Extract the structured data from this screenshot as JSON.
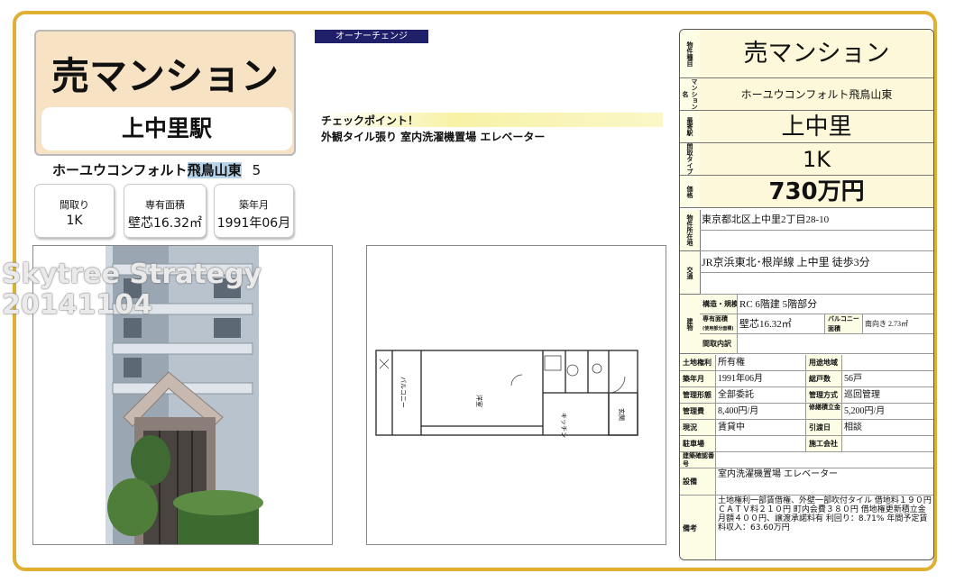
{
  "title": "売マンション",
  "station_title": "上中里駅",
  "property_name_prefix": "ホーユウコンフォルト",
  "property_name_hl": "飛鳥山東",
  "property_number": "5",
  "summary": [
    {
      "label": "間取り",
      "value": "1K"
    },
    {
      "label": "専有面積",
      "value": "壁芯16.32㎡"
    },
    {
      "label": "築年月",
      "value": "1991年06月"
    }
  ],
  "watermark": [
    "Skytree Strategy",
    "20141104"
  ],
  "owner_badge": "オーナーチェンジ",
  "checkpoint": {
    "header": "チェックポイント！",
    "text": "外観タイル張り 室内洗濯機置場 エレベーター"
  },
  "plan_labels": {
    "balcony": "バルコニー",
    "room": "洋室",
    "kitchen": "キッチン",
    "entrance": "玄関"
  },
  "table": {
    "type_label": "物件種目",
    "type_value": "売マンション",
    "name_label": "マンション名",
    "name_value": "ホーユウコンフォルト飛鳥山東",
    "station_label": "最寄駅",
    "station_value": "上中里",
    "layout_label": "間取タイプ",
    "layout_value": "1K",
    "price_label": "価格",
    "price_value": "730万円",
    "address_label": "物件所在地",
    "address_value": "東京都北区上中里2丁目28-10",
    "access_label": "交通",
    "access_value": "JR京浜東北･根岸線 上中里 徒歩3分",
    "building_label": "建物",
    "struct_label": "構造・規模",
    "struct_value": "RC 6階建 5階部分",
    "area_label": "専有面積",
    "area_sub": "(使用部分面積)",
    "area_value": "壁芯16.32㎡",
    "balcony_label": "バルコニー面積",
    "balcony_value": "南向き 2.73㎡",
    "layout_detail_label": "間取内訳",
    "land_right_label": "土地権利",
    "land_right_value": "所有権",
    "use_area_label": "用途地域",
    "built_label": "築年月",
    "built_value": "1991年06月",
    "units_label": "総戸数",
    "units_value": "56戸",
    "mgmt_form_label": "管理形態",
    "mgmt_form_value": "全部委託",
    "mgmt_method_label": "管理方式",
    "mgmt_method_value": "巡回管理",
    "mgmt_fee_label": "管理費",
    "mgmt_fee_value": "8,400円/月",
    "repair_label": "修繕積立金",
    "repair_value": "5,200円/月",
    "status_label": "現況",
    "status_value": "賃貸中",
    "handover_label": "引渡日",
    "handover_value": "相談",
    "parking_label": "駐車場",
    "builder_label": "施工会社",
    "permit_label": "建築確認番号",
    "equip_label": "設備",
    "equip_value": "室内洗濯機置場 エレベーター",
    "remarks_label": "備考",
    "remarks_value": "土地権利一部賃借権、外壁一部吹付タイル 借地料１９０円 ＣＡＴＶ料２１０円 町内会費３８０円 借地権更新積立金月額４００円、譲渡承諾料有 利回り：8.71% 年間予定賃料収入：63.60万円"
  }
}
